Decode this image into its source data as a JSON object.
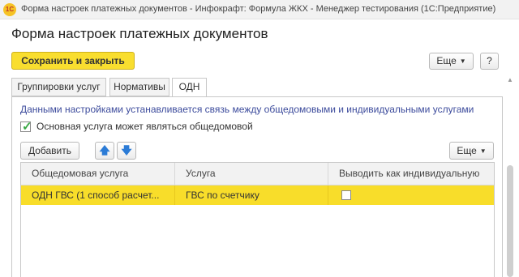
{
  "window": {
    "logo_text": "1С",
    "title": "Форма настроек платежных документов - Инфокрафт: Формула ЖКХ - Менеджер тестирования (1С:Предприятие)"
  },
  "form": {
    "title": "Форма настроек платежных документов"
  },
  "toolbar": {
    "save_close_label": "Сохранить и закрыть",
    "more_label": "Еще",
    "help_label": "?"
  },
  "tabs": [
    {
      "label": "Группировки услуг",
      "active": false
    },
    {
      "label": "Нормативы",
      "active": false
    },
    {
      "label": "ОДН",
      "active": true
    }
  ],
  "odn": {
    "info_text": "Данными настройками устанавливается связь между общедомовыми и индивидуальными услугами",
    "checkbox_label": "Основная услуга может являться общедомовой",
    "checkbox_checked": true,
    "add_label": "Добавить",
    "up_icon": "arrow-up-icon",
    "down_icon": "arrow-down-icon",
    "more_label": "Еще"
  },
  "table": {
    "columns": [
      "Общедомовая услуга",
      "Услуга",
      "Выводить как индивидуальную"
    ],
    "rows": [
      {
        "house_service": "ОДН ГВС (1 способ расчет...",
        "service": "ГВС по счетчику",
        "show_individual": false
      }
    ]
  },
  "colors": {
    "accent": "#f9de2f",
    "selected_row": "#f8dd2a",
    "info_text": "#3c4b9c",
    "check_green": "#3aa845"
  }
}
